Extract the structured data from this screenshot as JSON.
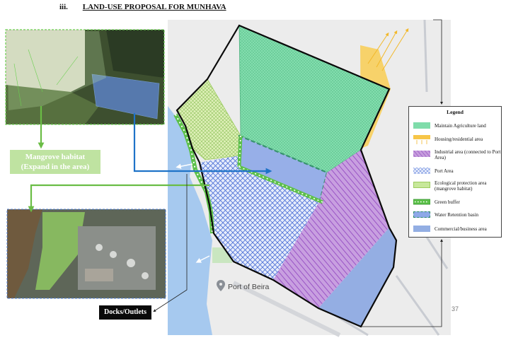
{
  "header": {
    "section_number": "iii.",
    "title": "LAND-USE PROPOSAL FOR MUNHAVA"
  },
  "callouts": {
    "mangrove_line1": "Mangrove habitat",
    "mangrove_line2": "(Expand in the area)",
    "docks": "Docks/Outlets"
  },
  "map": {
    "place_label": "Port of Beira",
    "place_icon": "map-pin-icon"
  },
  "legend": {
    "title": "Legend",
    "items": [
      {
        "label": "Maintain Agriculture land",
        "color": "#7fdcaa"
      },
      {
        "label": "Housing/residential area",
        "color": "#f7c648"
      },
      {
        "label": "Industrial area (connected to Port Area)",
        "color": "#b27dcc"
      },
      {
        "label": "Port Area",
        "color": "#9fb6ee"
      },
      {
        "label": "Ecological protection area (mangrove habitat)",
        "color": "#c7e89a"
      },
      {
        "label": "Green buffer",
        "color": "#5cc049"
      },
      {
        "label": "Water Retention basin",
        "color": "#2e8b6a"
      },
      {
        "label": "Commercial/business area",
        "color": "#93aee3"
      }
    ]
  },
  "page_number": "37",
  "colors": {
    "water": "#a6c9ef",
    "land": "#ececec",
    "arrow_green": "#6abd45",
    "arrow_blue": "#1f73c8"
  }
}
